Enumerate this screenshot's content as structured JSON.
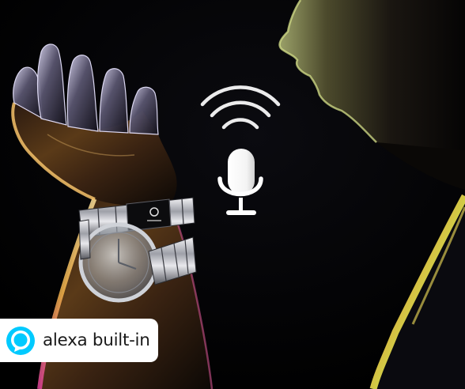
{
  "badge": {
    "label": "alexa built-in",
    "icon": "alexa-logo-icon",
    "accent_color": "#00caff"
  },
  "caption": {
    "text": "",
    "color": "#ffffff"
  },
  "icons": {
    "voice_waves": "wifi-waves-icon",
    "microphone": "microphone-icon"
  },
  "colors": {
    "background": "#020203",
    "rim_light_warm": "#f2b24a",
    "rim_light_cool": "#4fd6c8",
    "rim_light_magenta": "#e0409a"
  }
}
